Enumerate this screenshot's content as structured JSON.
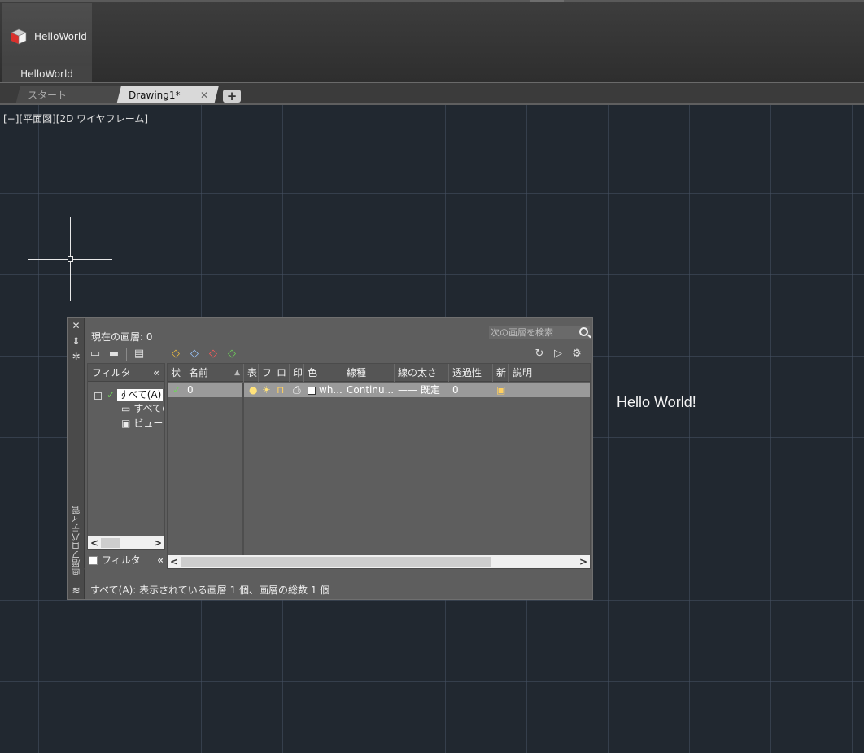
{
  "ribbon": {
    "button_label": "HelloWorld",
    "panel_title": "HelloWorld"
  },
  "tabs": {
    "start": "スタート",
    "drawing": "Drawing1*",
    "close_glyph": "✕",
    "add_glyph": "+"
  },
  "viewport": {
    "label": "[−][平面図][2D ワイヤフレーム]",
    "hello_text": "Hello World!"
  },
  "layer_palette": {
    "side_title": "画層プロパティ管理",
    "current_layer": "現在の画層: 0",
    "search_placeholder": "次の画層を検索",
    "filter_header": "フィルタ",
    "collapse_glyph": "«",
    "tree": {
      "all": "すべて(A)",
      "all_used": "すべての",
      "viewport": "ビューポ"
    },
    "invert_filter_label": "フィルタ",
    "columns": [
      "状",
      "名前",
      "表",
      "フ",
      "ロ",
      "印",
      "色",
      "線種",
      "線の太さ",
      "透過性",
      "新",
      "説明"
    ],
    "row": {
      "name": "0",
      "color": "wh...",
      "linetype": "Continu...",
      "lineweight": "—— 既定",
      "transparency": "0"
    },
    "status": "すべて(A): 表示されている画層 1 個、画層の総数 1 個"
  },
  "colors": {
    "viewport_bg": "#212830",
    "ribbon_bg": "#3d3d3d",
    "palette_bg": "#5e5e5e",
    "selected_row": "#9a9a9a"
  }
}
